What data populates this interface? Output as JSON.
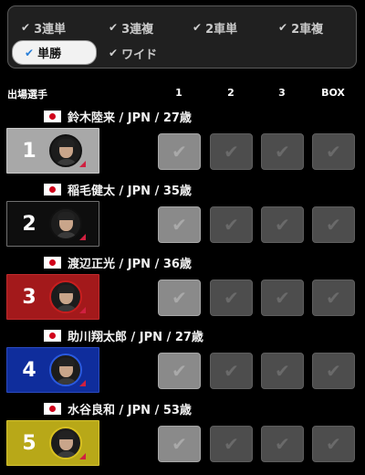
{
  "bet_types": [
    {
      "label": "3連単",
      "check": "✔",
      "active": false
    },
    {
      "label": "3連複",
      "check": "✔",
      "active": false
    },
    {
      "label": "2車単",
      "check": "✔",
      "active": false
    },
    {
      "label": "2車複",
      "check": "✔",
      "active": false
    },
    {
      "label": "単勝",
      "check": "✔",
      "active": true
    },
    {
      "label": "ワイド",
      "check": "✔",
      "active": false
    }
  ],
  "headers": {
    "rider": "出場選手",
    "col1": "1",
    "col2": "2",
    "col3": "3",
    "box": "BOX"
  },
  "check_glyph": "✔",
  "riders": [
    {
      "number": "1",
      "info": "鈴木陸来 / JPN / 27歳",
      "color": "#ffffff",
      "text_color": "#ffffff"
    },
    {
      "number": "2",
      "info": "稲毛健太 / JPN / 35歳",
      "color": "#000000",
      "text_color": "#ffffff"
    },
    {
      "number": "3",
      "info": "渡辺正光 / JPN / 36歳",
      "color": "#a3191b",
      "text_color": "#ffffff"
    },
    {
      "number": "4",
      "info": "助川翔太郎 / JPN / 27歳",
      "color": "#0f2d9c",
      "text_color": "#ffffff"
    },
    {
      "number": "5",
      "info": "水谷良和 / JPN / 53歳",
      "color": "#b8a818",
      "text_color": "#ffffff"
    }
  ]
}
